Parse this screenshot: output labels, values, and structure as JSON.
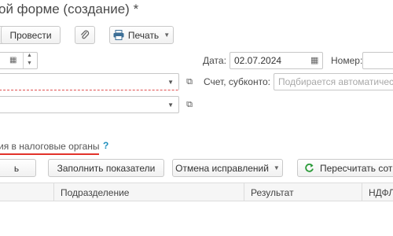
{
  "window": {
    "title": "ой форме (создание) *"
  },
  "toolbar": {
    "post_label": "Провести",
    "print_label": "Печать",
    "attach_icon": "paperclip-icon",
    "print_icon": "printer-icon"
  },
  "form": {
    "date_label": "Дата:",
    "date_value": "02.07.2024",
    "number_label": "Номер:",
    "account_label": "Счет, субконто:",
    "account_placeholder": "Подбирается автоматическ"
  },
  "section": {
    "link_text": "ия в налоговые органы",
    "help": "?",
    "accent_color": "#e2332b"
  },
  "actions": {
    "first_label": "ь",
    "fill_label": "Заполнить показатели",
    "cancel_fix_label": "Отмена исправлений",
    "recalc_label": "Пересчитать сотр"
  },
  "table": {
    "columns": [
      "Подразделение",
      "Результат",
      "НДФЛ"
    ]
  }
}
